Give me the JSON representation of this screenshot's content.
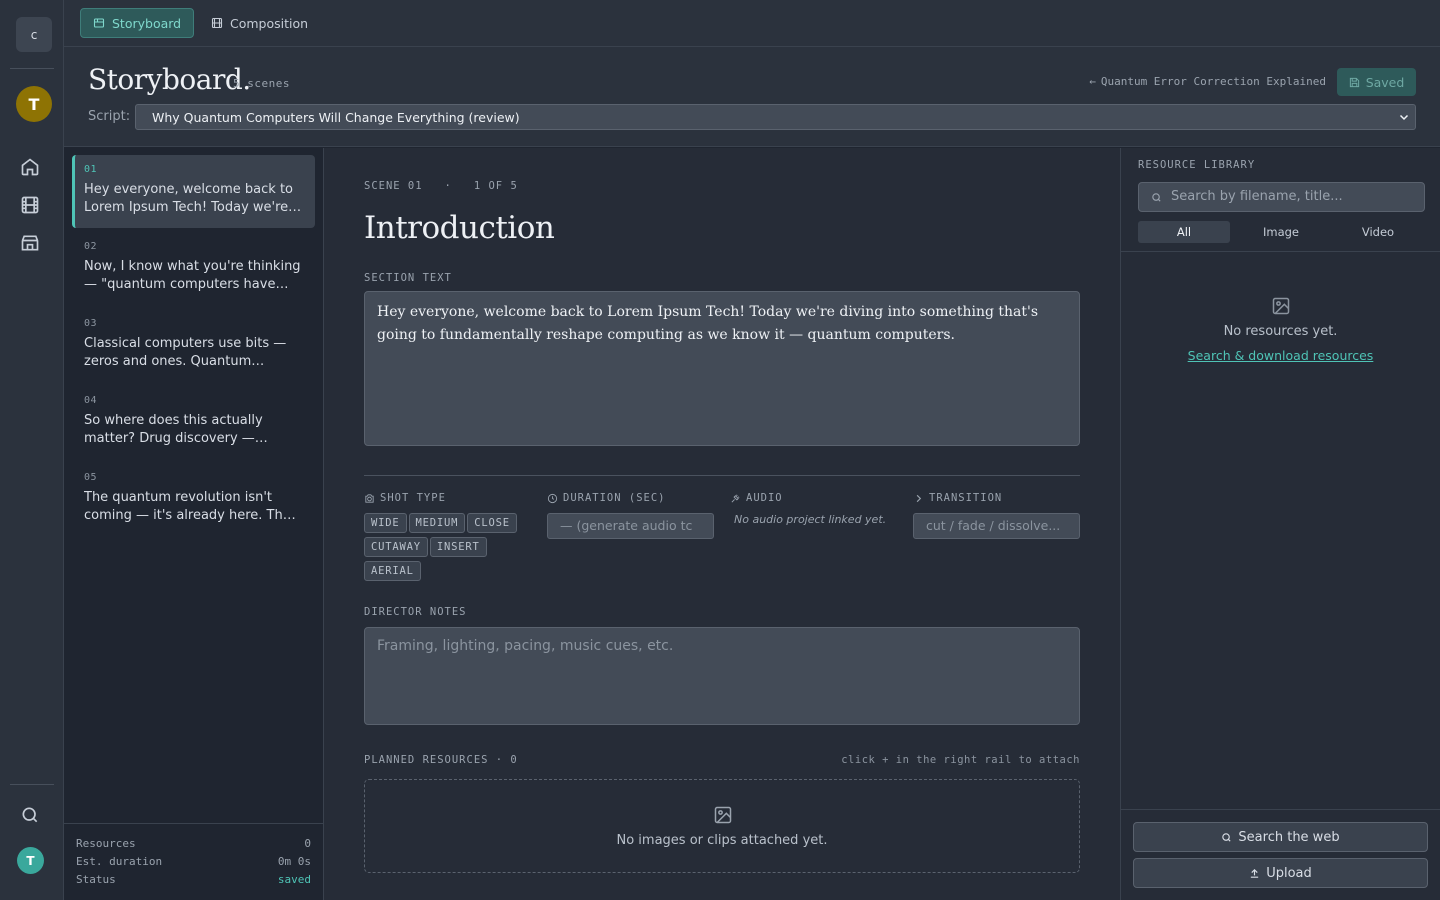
{
  "rail": {
    "logo": "c",
    "avatar_top": "T",
    "avatar_bottom": "T"
  },
  "tabs": [
    {
      "label": "Storyboard",
      "icon": "storyboard-icon",
      "active": true
    },
    {
      "label": "Composition",
      "icon": "film-icon",
      "active": false
    }
  ],
  "header": {
    "title": "Storyboard.",
    "scene_count": "5 scenes",
    "back_link": "Quantum Error Correction Explained",
    "saved_label": "Saved",
    "script_label": "Script:",
    "script_value": "Why Quantum Computers Will Change Everything (review)"
  },
  "scenes": [
    {
      "num": "01",
      "text": "Hey everyone, welcome back to Lorem Ipsum Tech! Today we're diving into something that's going to fundamentally reshape",
      "active": true
    },
    {
      "num": "02",
      "text": "Now, I know what you're thinking — \"quantum computers have been the next big thing forever\"",
      "active": false
    },
    {
      "num": "03",
      "text": "Classical computers use bits — zeros and ones. Quantum computers use qubits",
      "active": false
    },
    {
      "num": "04",
      "text": "So where does this actually matter? Drug discovery — simulating molecules",
      "active": false
    },
    {
      "num": "05",
      "text": "The quantum revolution isn't coming — it's already here. The question is",
      "active": false
    }
  ],
  "scene_footer": {
    "resources_label": "Resources",
    "resources_value": "0",
    "duration_label": "Est. duration",
    "duration_value": "0m 0s",
    "status_label": "Status",
    "status_value": "saved"
  },
  "main": {
    "scene_label": "SCENE 01",
    "scene_position": "1 OF 5",
    "scene_title": "Introduction",
    "section_text_label": "SECTION TEXT",
    "section_text": "Hey everyone, welcome back to Lorem Ipsum Tech! Today we're diving into something that's going to fundamentally reshape computing as we know it — quantum computers.",
    "shot_type_label": "SHOT TYPE",
    "shot_types": [
      "WIDE",
      "MEDIUM",
      "CLOSE",
      "CUTAWAY",
      "INSERT",
      "AERIAL"
    ],
    "duration_label": "DURATION (SEC)",
    "duration_placeholder": "— (generate audio tc",
    "audio_label": "AUDIO",
    "audio_note": "No audio project linked yet.",
    "transition_label": "TRANSITION",
    "transition_placeholder": "cut / fade / dissolve...",
    "director_notes_label": "DIRECTOR NOTES",
    "director_notes_placeholder": "Framing, lighting, pacing, music cues, etc.",
    "planned_label": "PLANNED RESOURCES · 0",
    "planned_hint": "click + in the right rail to attach",
    "planned_empty": "No images or clips attached yet."
  },
  "resources": {
    "label": "RESOURCE LIBRARY",
    "search_placeholder": "Search by filename, title...",
    "filters": [
      {
        "label": "All",
        "active": true
      },
      {
        "label": "Image",
        "active": false
      },
      {
        "label": "Video",
        "active": false
      }
    ],
    "empty_text": "No resources yet.",
    "empty_link": "Search & download resources",
    "search_web_label": "Search the web",
    "upload_label": "Upload"
  },
  "colors": {
    "accent": "#4fc4b6",
    "avatar": "#8e7304",
    "background": "#1f2530"
  }
}
